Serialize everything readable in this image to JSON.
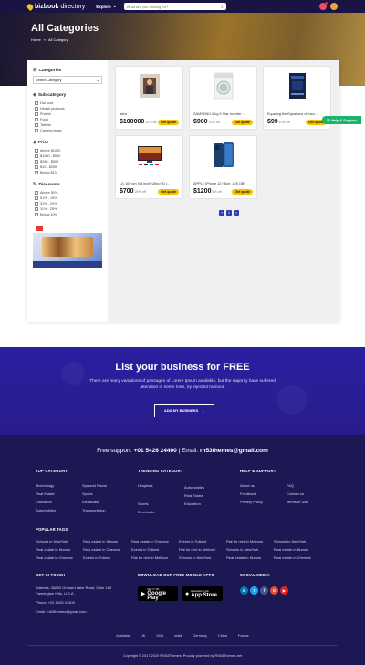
{
  "header": {
    "logo_bold": "bizbook",
    "logo_light": " directory",
    "explore_label": "Explore",
    "search_placeholder": "What are you looking for?"
  },
  "hero": {
    "title": "All Categories",
    "breadcrumb": [
      "Home",
      "»",
      "All Category"
    ]
  },
  "sidebar": {
    "categories_title": "Categories",
    "select_value": "Select Category",
    "subcategory_title": "Sub category",
    "subcategories": [
      "Dal food",
      "Health products",
      "Protein",
      "Food",
      "Tablets",
      "Camera lense"
    ],
    "price_title": "Price",
    "prices": [
      "Above $1000",
      "$1000 - $500",
      "$250 - $500",
      "$10 - $250",
      "Below $10"
    ],
    "discounts_title": "Discounts",
    "discounts": [
      "Above 50%",
      "51% - 15%",
      "31% - 20%",
      "11% - 25%",
      "Below 10%"
    ]
  },
  "products": [
    {
      "title": "adcs",
      "price": "$100000",
      "off": "12% off",
      "cta": "Get quote"
    },
    {
      "title": "SAMSUNG 6 kg 5 Star Inverter ...",
      "price": "$900",
      "off": "10% off",
      "cta": "Get quote"
    },
    {
      "title": "Equating the Equations of Inso...",
      "price": "$99",
      "off": "10% off",
      "cta": "Get quote"
    },
    {
      "title": "LG 109 cm (43 inch) Ultra HD (...",
      "price": "$700",
      "off": "20% off",
      "cta": "Get quote"
    },
    {
      "title": "APPLE iPhone 12 (Blue, 128 GB)",
      "price": "$1200",
      "off": "5% off",
      "cta": "Get quote"
    }
  ],
  "pagination": [
    "«",
    "1",
    "»"
  ],
  "help_button": "Help & Support",
  "cta": {
    "title": "List your business for FREE",
    "text": "There are many variations of passages of Lorem Ipsum available, but the majority have suffered alteration in some form, by injected humour.",
    "button": "ADD MY BUSINESS"
  },
  "footer": {
    "support_label": "Free support:",
    "support_phone": "+01 5426 24400",
    "email_label": "Email:",
    "support_email": "rn53themes@gmail.com",
    "top_category_title": "TOP CATEGORY",
    "top_category": [
      "Technology",
      "Real Estate",
      "Education",
      "Automobiles",
      "Spa and Facial",
      "Sports",
      "Electricals",
      "Transportation"
    ],
    "trending_title": "TRENDING CATEGORY",
    "trending": [
      "Hospitals",
      "Sports",
      "Electricals",
      "Automobiles",
      "Real Estate",
      "Education"
    ],
    "help_title": "HELP & SUPPORT",
    "help": [
      "About us",
      "Feedback",
      "Privacy Policy",
      "FAQ",
      "Contact us",
      "Terms of Use"
    ],
    "popular_title": "POPULAR TAGS",
    "tags": [
      "Schools in NewYork",
      "Real estate in Illunois",
      "Real estate in Chennai",
      "Events in Tolland",
      "Flat for rent in Melborn",
      "Schools in NewYork",
      "Real estate in Illunois",
      "Real estate in Chennai",
      "Events in Tolland",
      "Flat for rent in Melborn",
      "Schools in NewYork",
      "Real estate in Illunois",
      "Real estate in Chennai",
      "Events in Tolland",
      "Flat for rent in Melborn",
      "Schools in NewYork",
      "Real estate in Illunois",
      "Real estate in Chennai"
    ],
    "get_in_touch_title": "GET IN TOUCH",
    "address": "Address: 28800 Orchard Lake Road, Suite 180 Farmington Hills, U.S.A.",
    "phone": "Phone: +01 5426 24400",
    "email_line": "Email: rn53themes@gmail.com",
    "apps_title": "DOWNLOAD OUR FREE MOBILE APPS",
    "google_small": "GET IT ON",
    "google_big": "Google Play",
    "apple_small": "Download on the",
    "apple_big": "App Store",
    "social_title": "SOCIAL MEDIA",
    "countries": [
      "Australia",
      "UK",
      "USA",
      "India",
      "Germany",
      "China",
      "France"
    ],
    "copyright": "Copyright © 2017-2020 RN53Themes. Proudly powered by RN53Themes.net"
  },
  "colors": {
    "header_bg": "#1a1444",
    "cta_bg": "#2a1f9d",
    "footer_bg": "#1b1854",
    "quote_btn": "#f5c400",
    "help_btn": "#17b66a",
    "pager": "#2d3bb5"
  },
  "icons": [
    "logo-pin-icon",
    "chevron-down-icon",
    "search-icon",
    "list-icon",
    "tag-icon",
    "percent-icon",
    "whatsapp-icon",
    "arrow-right-icon",
    "linkedin-icon",
    "twitter-icon",
    "facebook-icon",
    "google-plus-icon",
    "youtube-icon"
  ]
}
